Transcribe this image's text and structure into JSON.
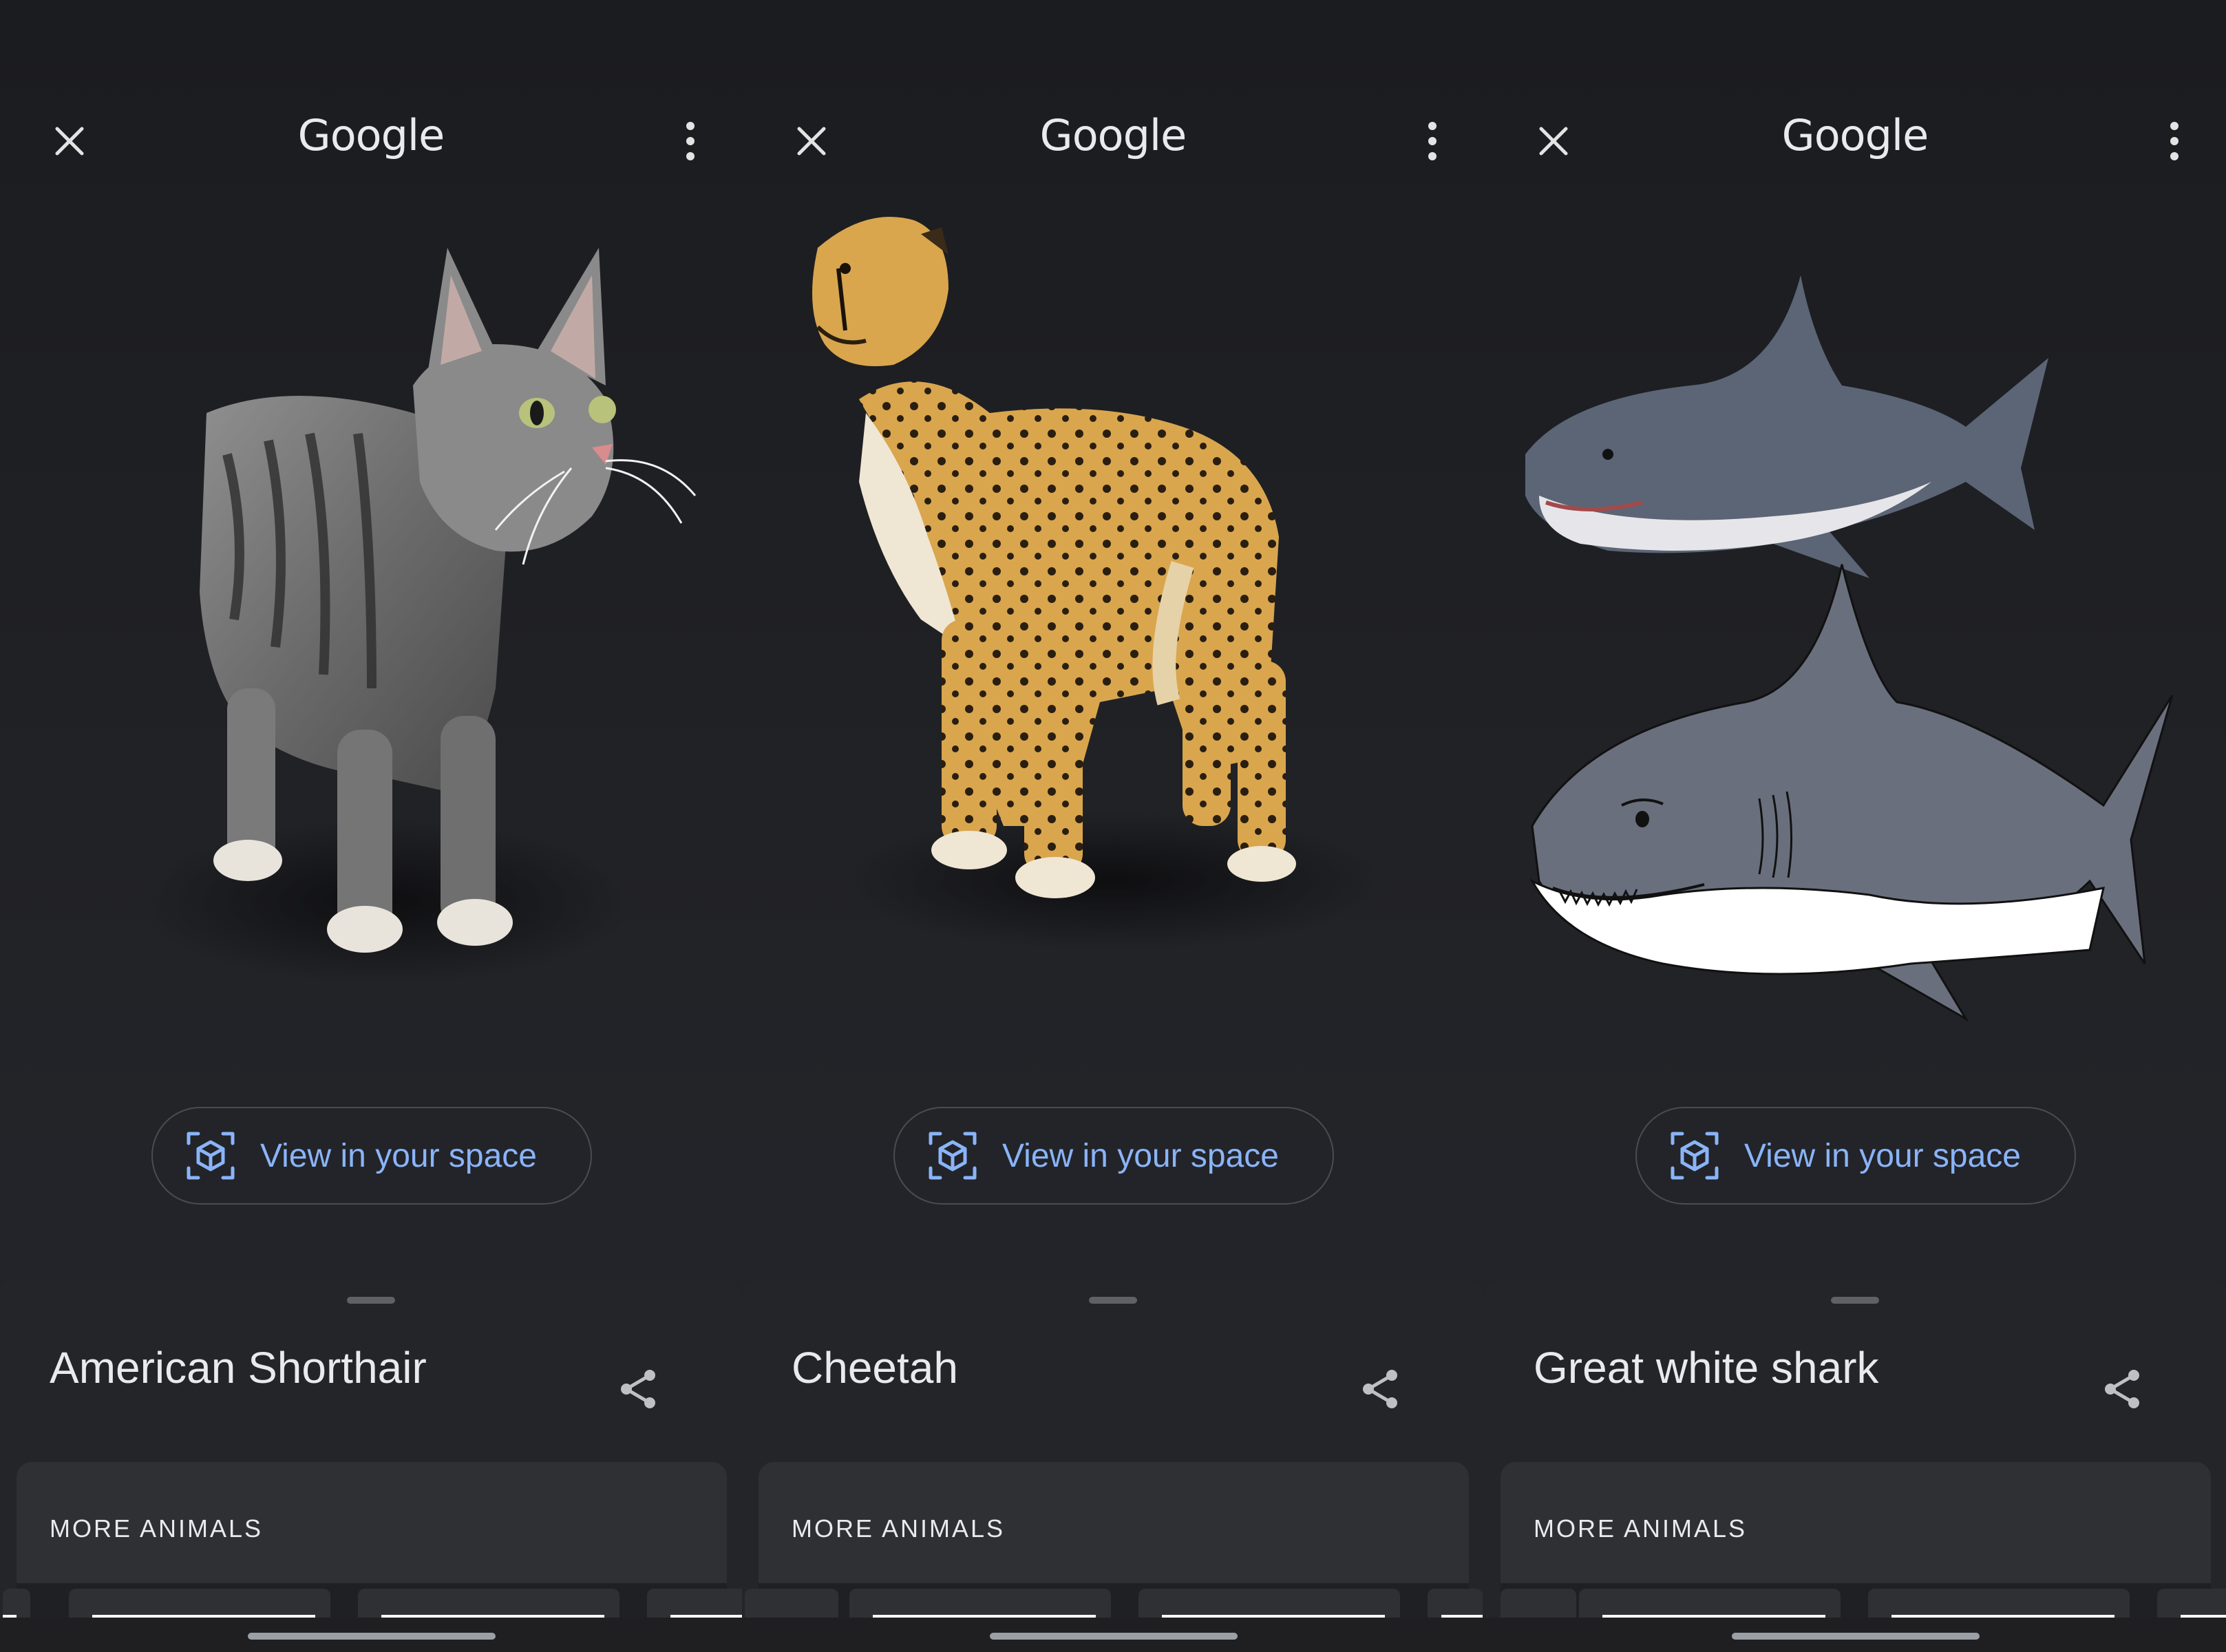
{
  "screens": [
    {
      "top_bar": {
        "logo": "Google",
        "close_icon": "close-icon",
        "menu_icon": "more-vert-icon"
      },
      "model": {
        "icon": "3d-cat-model"
      },
      "ar_button": {
        "label": "View in your space",
        "icon": "ar-cube-icon"
      },
      "sheet": {
        "title": "American Shorthair",
        "share_icon": "share-icon",
        "section_label": "MORE ANIMALS"
      }
    },
    {
      "top_bar": {
        "logo": "Google",
        "close_icon": "close-icon",
        "menu_icon": "more-vert-icon"
      },
      "model": {
        "icon": "3d-cheetah-model"
      },
      "ar_button": {
        "label": "View in your space",
        "icon": "ar-cube-icon"
      },
      "sheet": {
        "title": "Cheetah",
        "share_icon": "share-icon",
        "section_label": "MORE ANIMALS"
      }
    },
    {
      "top_bar": {
        "logo": "Google",
        "close_icon": "close-icon",
        "menu_icon": "more-vert-icon"
      },
      "model": {
        "icon": "3d-shark-model"
      },
      "ar_button": {
        "label": "View in your space",
        "icon": "ar-cube-icon"
      },
      "sheet": {
        "title": "Great white shark",
        "share_icon": "share-icon",
        "section_label": "MORE ANIMALS"
      }
    }
  ],
  "colors": {
    "background": "#1b1c20",
    "sheet": "#242529",
    "card": "#2f3034",
    "accent_link": "#8ab4f8",
    "text": "#e8eaed"
  }
}
